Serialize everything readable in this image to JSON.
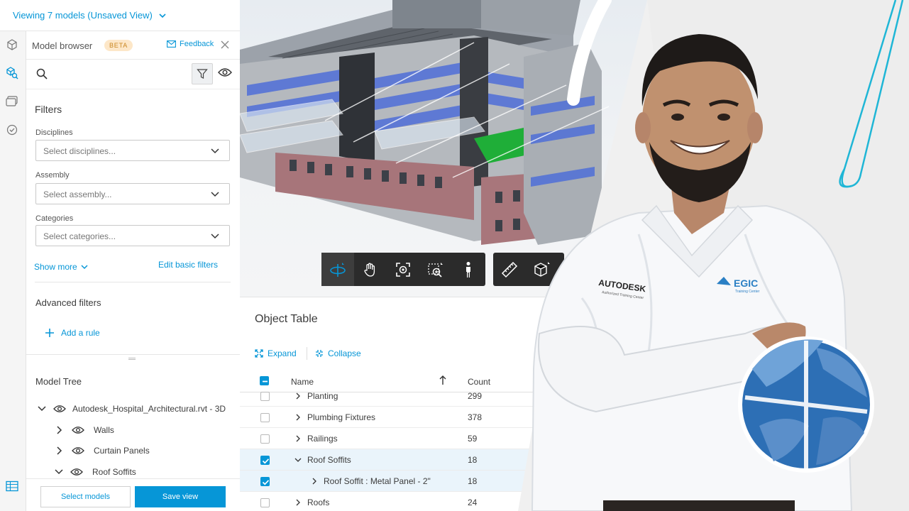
{
  "topbar": {
    "viewing_label": "Viewing 7 models (Unsaved View)"
  },
  "panel": {
    "title": "Model browser",
    "beta": "BETA",
    "feedback": "Feedback",
    "filters_heading": "Filters",
    "disciplines_label": "Disciplines",
    "disciplines_placeholder": "Select disciplines...",
    "assembly_label": "Assembly",
    "assembly_placeholder": "Select assembly...",
    "categories_label": "Categories",
    "categories_placeholder": "Select categories...",
    "show_more": "Show more",
    "edit_basic_filters": "Edit basic filters",
    "advanced_filters": "Advanced filters",
    "add_rule": "Add a rule",
    "model_tree": "Model Tree",
    "tree": [
      {
        "label": "Autodesk_Hospital_Architectural.rvt - 3D",
        "expanded": true
      },
      {
        "label": "Walls",
        "expanded": false
      },
      {
        "label": "Curtain Panels",
        "expanded": false
      },
      {
        "label": "Roof Soffits",
        "expanded": true
      }
    ],
    "select_models": "Select models",
    "save_view": "Save view"
  },
  "object_table": {
    "title": "Object Table",
    "expand": "Expand",
    "collapse": "Collapse",
    "col_name": "Name",
    "col_count": "Count",
    "rows": [
      {
        "name": "Planting",
        "count": "299",
        "checked": false,
        "expanded": false
      },
      {
        "name": "Plumbing Fixtures",
        "count": "378",
        "checked": false,
        "expanded": false
      },
      {
        "name": "Railings",
        "count": "59",
        "checked": false,
        "expanded": false
      },
      {
        "name": "Roof Soffits",
        "count": "18",
        "checked": true,
        "expanded": true
      },
      {
        "name": "Roof Soffit : Metal Panel - 2\"",
        "count": "18",
        "checked": true,
        "expanded": false
      },
      {
        "name": "Roofs",
        "count": "24",
        "checked": false,
        "expanded": false
      }
    ]
  },
  "toolbar": {
    "items": [
      "orbit-icon",
      "pan-icon",
      "fit-to-view-icon",
      "zoom-window-icon",
      "first-person-icon",
      "measure-icon",
      "section-box-icon"
    ]
  },
  "badges": {
    "shirt_logo_left": "AUTODESK",
    "shirt_logo_left_sub": "Authorized Training Center",
    "shirt_logo_right": "EGIC",
    "shirt_logo_right_sub": "Training Center"
  },
  "colors": {
    "accent": "#0696d7",
    "beta_bg": "#fde7c8",
    "toolbar_bg": "#2b2b2b"
  }
}
